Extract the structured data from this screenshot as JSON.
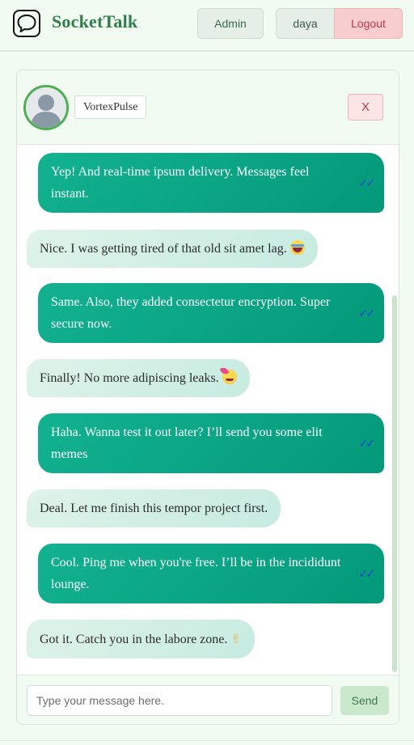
{
  "app": {
    "brand": "SocketTalk",
    "icons": {
      "logo": "chat-bubble-icon"
    }
  },
  "navbar": {
    "admin_label": "Admin",
    "user_label": "daya",
    "logout_label": "Logout"
  },
  "chat": {
    "contact_name": "VortexPulse",
    "close_label": "X",
    "avatar_icon": "user-silhouette-icon",
    "messages": [
      {
        "from": "me",
        "text": "Yep! And real-time ipsum delivery. Messages feel instant.",
        "status": "✓✓"
      },
      {
        "from": "them",
        "text": "Nice. I was getting tired of that old sit amet lag.",
        "emoji": "laughing-emoji"
      },
      {
        "from": "me",
        "text": "Same. Also, they added consectetur encryption. Super secure now.",
        "status": "✓✓"
      },
      {
        "from": "them",
        "text": "Finally! No more adipiscing leaks.",
        "emoji": "partying-emoji"
      },
      {
        "from": "me",
        "text": "Haha. Wanna test it out later? I’ll send you some elit memes",
        "status": "✓✓"
      },
      {
        "from": "them",
        "text": "Deal. Let me finish this tempor project first."
      },
      {
        "from": "me",
        "text": "Cool. Ping me when you're free. I’ll be in the incididunt lounge.",
        "status": "✓✓"
      },
      {
        "from": "them",
        "text": "Got it. Catch you in the labore zone.",
        "emoji": "✌"
      }
    ]
  },
  "composer": {
    "placeholder": "Type your message here.",
    "send_label": "Send"
  },
  "colors": {
    "sent_bubble": "#0aa584",
    "received_bubble": "#d2efe5",
    "brand": "#2f7d4a",
    "logout": "#f8cdd0",
    "read_tick": "#1a3fd6"
  }
}
